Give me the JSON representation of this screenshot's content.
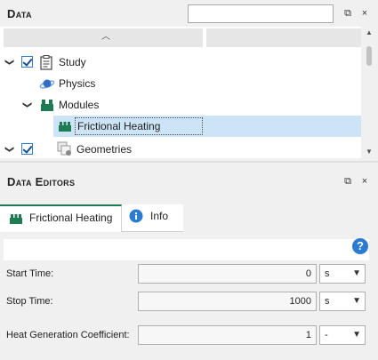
{
  "data_panel": {
    "title": "Data",
    "search": {
      "value": "",
      "placeholder": ""
    },
    "buttons": {
      "float": "⧉",
      "close": "×"
    },
    "tree": [
      {
        "label": "Study",
        "expanded": true,
        "checked": true,
        "icon": "clipboard-icon"
      },
      {
        "label": "Physics",
        "icon": "physics-planet-icon"
      },
      {
        "label": "Modules",
        "expanded": true,
        "icon": "modules-icon"
      },
      {
        "label": "Frictional Heating",
        "icon": "module-block-icon",
        "selected": true
      },
      {
        "label": "Geometries",
        "expanded": true,
        "checked": true,
        "icon": "geometries-icon"
      }
    ]
  },
  "editors_panel": {
    "title": "Data Editors",
    "buttons": {
      "float": "⧉",
      "close": "×"
    },
    "tabs": [
      {
        "label": "Frictional Heating",
        "icon": "module-block-icon",
        "active": true
      },
      {
        "label": "Info",
        "icon": "info-icon",
        "active": false
      }
    ],
    "help": "?",
    "fields": [
      {
        "label": "Start Time:",
        "value": "0",
        "unit": "s"
      },
      {
        "label": "Stop Time:",
        "value": "1000",
        "unit": "s"
      },
      {
        "label": "Heat Generation Coefficient:",
        "value": "1",
        "unit": "-"
      }
    ]
  },
  "colors": {
    "accent_green": "#1e7b54",
    "selection": "#cde4f7",
    "info_blue": "#2b7bd1",
    "checkbox_blue": "#3a7bc8"
  }
}
